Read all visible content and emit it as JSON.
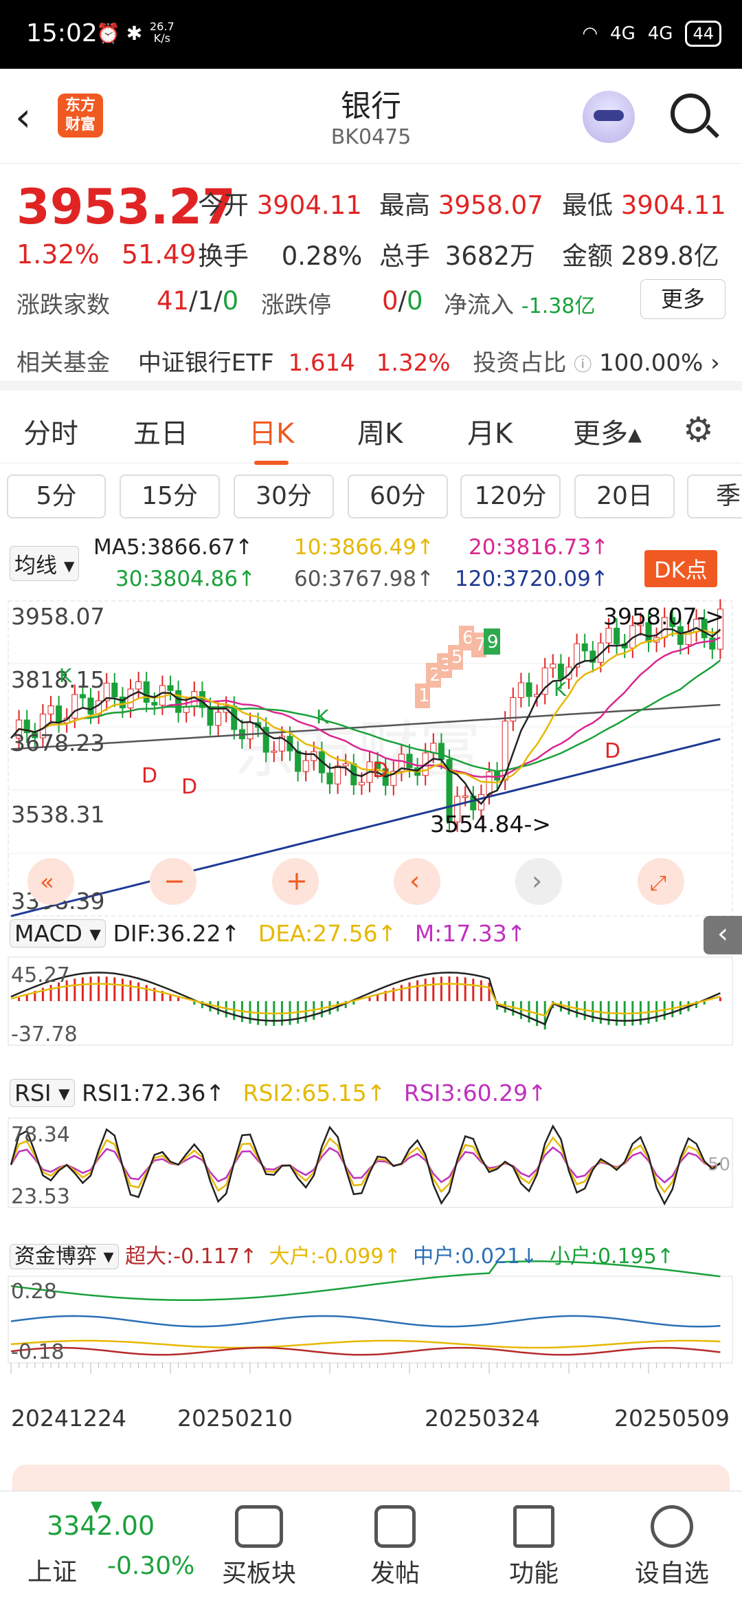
{
  "status_bar": {
    "time": "15:02",
    "speed": "26.7\nK/s",
    "signal1": "4G",
    "signal2": "4G",
    "battery": "44"
  },
  "header": {
    "title": "银行",
    "code": "BK0475",
    "logo_text": "东方\n财富"
  },
  "quote": {
    "price": "3953.27",
    "change_pct": "1.32%",
    "change_val": "51.49",
    "open_label": "今开",
    "open": "3904.11",
    "high_label": "最高",
    "high": "3958.07",
    "low_label": "最低",
    "low": "3904.11",
    "turnover_label": "换手",
    "turnover": "0.28%",
    "volume_label": "总手",
    "volume": "3682万",
    "amount_label": "金额",
    "amount": "289.8亿",
    "updown_label": "涨跌家数",
    "up": "41",
    "flat": "1",
    "down": "0",
    "limit_label": "涨跌停",
    "limit_up": "0",
    "limit_down": "0",
    "netflow_label": "净流入",
    "netflow": "-1.38亿",
    "more_label": "更多"
  },
  "fund": {
    "label": "相关基金",
    "name": "中证银行ETF",
    "price": "1.614",
    "pct": "1.32%",
    "ratio_label": "投资占比",
    "ratio": "100.00%"
  },
  "tabs": [
    "分时",
    "五日",
    "日K",
    "周K",
    "月K",
    "更多▴"
  ],
  "active_tab": "日K",
  "periods": [
    "5分",
    "15分",
    "30分",
    "60分",
    "120分",
    "20日",
    "季"
  ],
  "ma": {
    "selector": "均线",
    "ma5": "MA5:3866.67↑",
    "ma10": "10:3866.49↑",
    "ma20": "20:3816.73↑",
    "ma30": "30:3804.86↑",
    "ma60": "60:3767.98↑",
    "ma120": "120:3720.09↑",
    "dk_label": "DK点"
  },
  "kline": {
    "ymax": "3958.07",
    "y2": "3818.15",
    "y3": "3678.23",
    "y4": "3538.31",
    "ymin": "3398.39",
    "high_note": "3958.07->",
    "low_note": "3554.84->",
    "watermark": "东方财富"
  },
  "macd": {
    "selector": "MACD",
    "dif": "DIF:36.22↑",
    "dea": "DEA:27.56↑",
    "m": "M:17.33↑",
    "top": "45.27",
    "bottom": "-37.78"
  },
  "rsi": {
    "selector": "RSI",
    "rsi1": "RSI1:72.36↑",
    "rsi2": "RSI2:65.15↑",
    "rsi3": "RSI3:60.29↑",
    "top": "78.34",
    "bottom": "23.53",
    "mid": "50"
  },
  "fund_flow": {
    "selector": "资金博弈",
    "super": "超大:-0.117↑",
    "large": "大户:-0.099↑",
    "mid": "中户:0.021↓",
    "small": "小户:0.195↑",
    "top": "0.28",
    "bottom": "-0.18"
  },
  "dates": [
    "20241224",
    "20250210",
    "20250324",
    "20250509"
  ],
  "bottom_nav": {
    "index_price": "3342.00",
    "index_name": "上证",
    "index_pct": "-0.30%",
    "items": [
      "买板块",
      "发帖",
      "功能",
      "设自选"
    ]
  },
  "colors": {
    "up": "#e02424",
    "down": "#1aa13a",
    "accent": "#f05a22",
    "ma5": "#222222",
    "ma10": "#e6b800",
    "ma20": "#d9268f",
    "ma30": "#1aa13a",
    "ma60": "#555555",
    "ma120": "#1f3a93"
  }
}
